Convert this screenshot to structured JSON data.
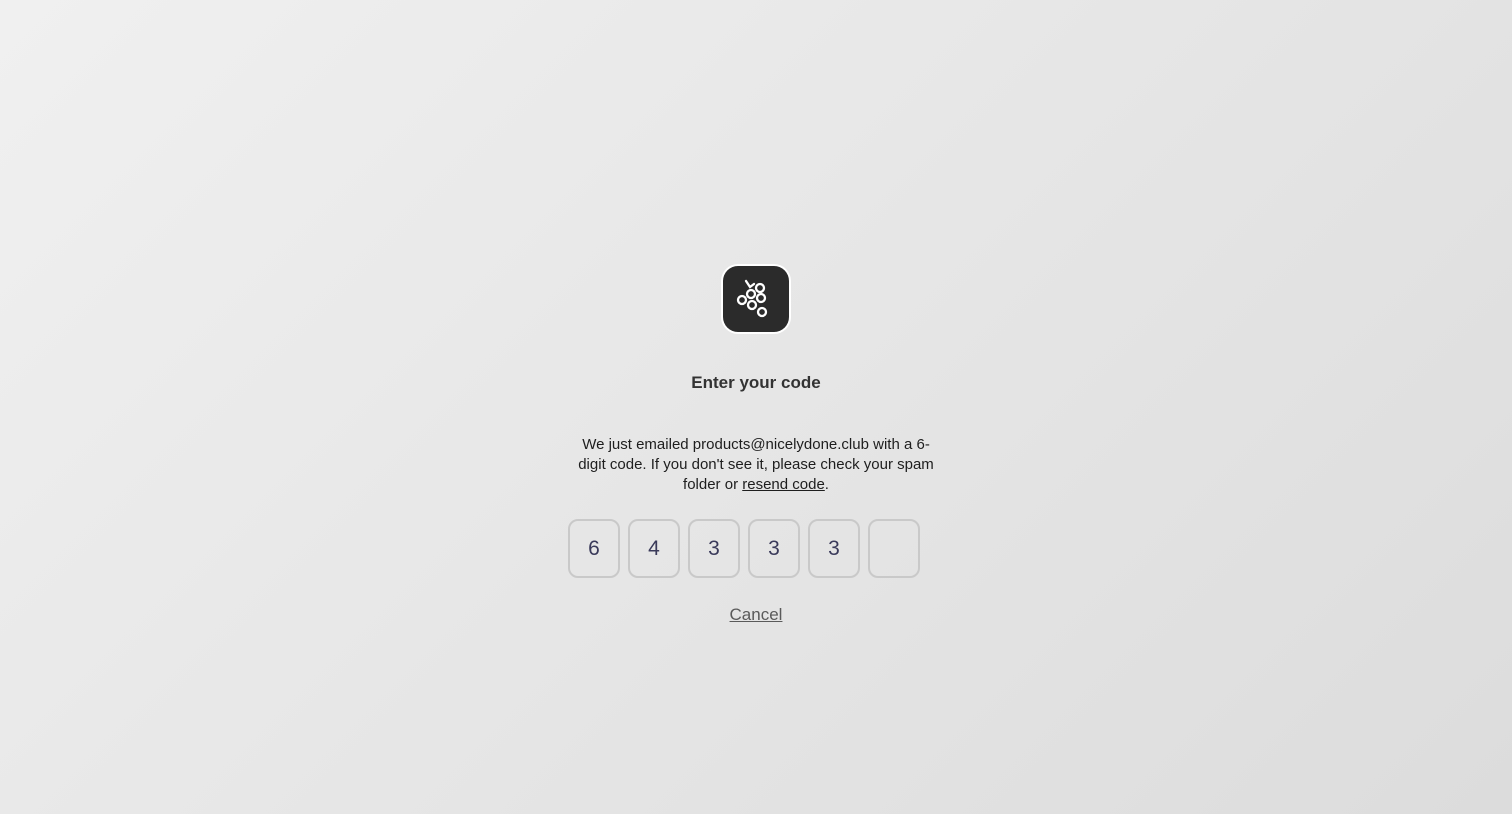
{
  "logo": {
    "icon": "grapes-icon",
    "background": "#2b2b2b"
  },
  "title": "Enter your code",
  "description": {
    "prefix": "We just emailed products@nicelydone.club with a 6-digit code. If you don't see it, please check your spam folder or ",
    "resend_link": "resend code",
    "suffix": "."
  },
  "code_digits": [
    "6",
    "4",
    "3",
    "3",
    "3",
    ""
  ],
  "cancel_label": "Cancel",
  "colors": {
    "digit_text": "#3a3a5a",
    "box_border": "#c9c9c9"
  }
}
